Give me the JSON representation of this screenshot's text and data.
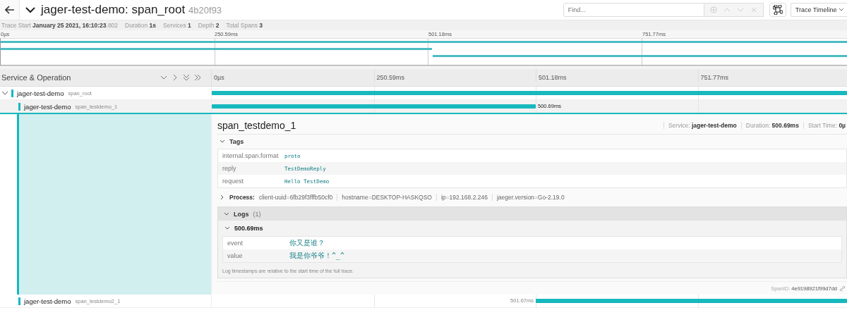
{
  "header": {
    "title": "jager-test-demo: span_root",
    "trace_id": "4b20f93",
    "expanded": true,
    "find": {
      "placeholder": "Find..."
    },
    "view_select": "Trace Timeline"
  },
  "meta": [
    {
      "label": "Trace Start",
      "value": "January 25 2021, 16:10:23",
      "suffix": ".802"
    },
    {
      "label": "Duration",
      "value": "1s"
    },
    {
      "label": "Services",
      "value": "1"
    },
    {
      "label": "Depth",
      "value": "2"
    },
    {
      "label": "Total Spans",
      "value": "3"
    }
  ],
  "ticks": [
    "0µs",
    "250.59ms",
    "501.18ms",
    "751.77ms"
  ],
  "minimap_ticks": [
    "0µs",
    "250.59ms",
    "501.18ms",
    "751.77ms"
  ],
  "column_header": "Service & Operation",
  "spans": [
    {
      "service": "jager-test-demo",
      "operation": "span_root",
      "expanded": true,
      "selected": false,
      "align_end": false,
      "level": 1
    },
    {
      "service": "jager-test-demo",
      "operation": "span_testdemo_1",
      "expanded": true,
      "selected": true,
      "align_end": false,
      "level": 0.51,
      "duration": "500.69ms"
    },
    {
      "service": "jager-test-demo",
      "operation": "span_testdemo2_1",
      "expanded": false,
      "selected": false,
      "align_end": true,
      "level": 0.49,
      "duration": "501.67ms"
    }
  ],
  "detail": {
    "title": "span_testdemo_1",
    "stats": [
      {
        "label": "Service:",
        "value": "jager-test-demo"
      },
      {
        "label": "Duration:",
        "value": "500.69ms"
      },
      {
        "label": "Start Time:",
        "value": "0µ"
      }
    ],
    "tags": {
      "title": "Tags",
      "expanded": true,
      "rows": [
        {
          "key": "internal.span.format",
          "value": "proto"
        },
        {
          "key": "reply",
          "value": "TestDemoReply"
        },
        {
          "key": "request",
          "value": "Hello TestDemo"
        }
      ]
    },
    "process": {
      "title": "Process:",
      "expanded": false,
      "items": [
        {
          "key": "client-uuid",
          "separator": "=",
          "value": "6fb29f3fffb50cf0"
        },
        {
          "key": "hostname",
          "separator": "=",
          "value": "DESKTOP-HASKQSO"
        },
        {
          "key": "ip",
          "separator": "=",
          "value": "192.168.2.246"
        },
        {
          "key": "jaeger.version",
          "separator": "=",
          "value": "Go-2.19.0"
        }
      ]
    },
    "logs": {
      "title": "Logs",
      "count": "(1)",
      "expanded": true,
      "entries": [
        {
          "time": "500.69ms",
          "expanded": true,
          "rows": [
            {
              "key": "event",
              "value": "你又是谁？"
            },
            {
              "key": "value",
              "value": "我是你爷爷！^_^"
            }
          ]
        }
      ],
      "note": "Log timestamps are relative to the start time of the full trace."
    },
    "span_id_label": "SpanID:",
    "span_id": "4e9198921f99d7dd"
  }
}
